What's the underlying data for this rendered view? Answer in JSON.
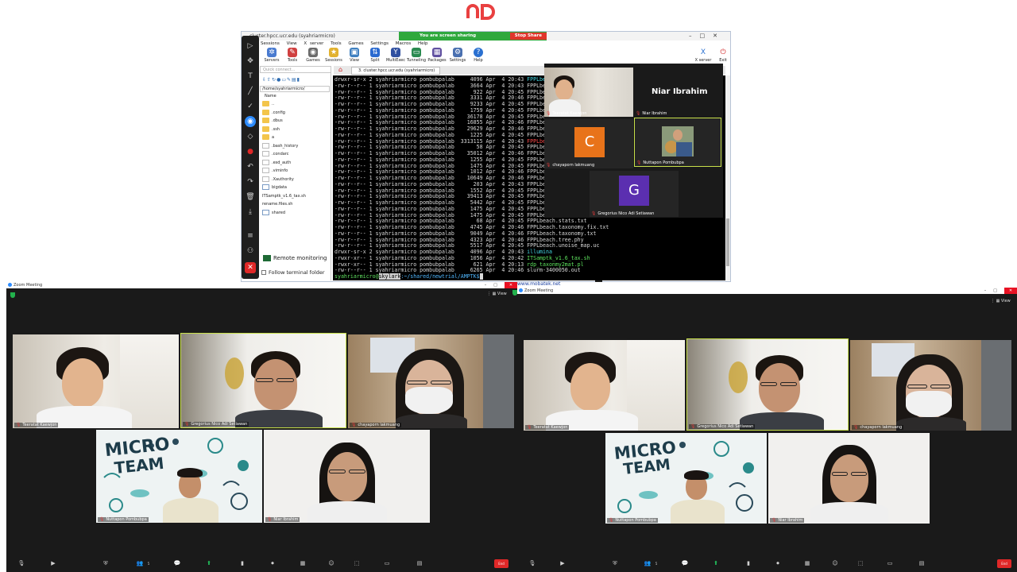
{
  "moba": {
    "window_title": "cluster.hpcc.ucr.edu (syahriarmicro)",
    "share_text": "You are screen sharing",
    "stop_share": "Stop Share",
    "menu": [
      "Sessions",
      "View",
      "X server",
      "Tools",
      "Games",
      "Settings",
      "Macros",
      "Help"
    ],
    "tools": [
      {
        "label": "Servers",
        "icon": "servers-icon",
        "color": "#4a7bd0"
      },
      {
        "label": "Tools",
        "icon": "tools-icon",
        "color": "#d04040"
      },
      {
        "label": "Games",
        "icon": "games-icon",
        "color": "#6a6a6a"
      },
      {
        "label": "Sessions",
        "icon": "sessions-icon",
        "color": "#e2b230"
      },
      {
        "label": "View",
        "icon": "view-icon",
        "color": "#4080c0"
      },
      {
        "label": "Split",
        "icon": "split-icon",
        "color": "#2a6ad0"
      },
      {
        "label": "MultiExec",
        "icon": "multiexec-icon",
        "color": "#3050a0"
      },
      {
        "label": "Tunneling",
        "icon": "tunneling-icon",
        "color": "#2a8a50"
      },
      {
        "label": "Packages",
        "icon": "packages-icon",
        "color": "#6050a0"
      },
      {
        "label": "Settings",
        "icon": "settings-icon",
        "color": "#4a70b0"
      },
      {
        "label": "Help",
        "icon": "help-icon",
        "color": "#2a70d0"
      }
    ],
    "xserver_label": "X server",
    "exit_label": "Exit",
    "quick_connect": "Quick connect...",
    "path": "/home/syahriarmicro/",
    "name_header": "Name",
    "files": [
      {
        "name": "..",
        "type": "folder"
      },
      {
        "name": ".config",
        "type": "folder"
      },
      {
        "name": ".dbus",
        "type": "folder"
      },
      {
        "name": ".ssh",
        "type": "folder"
      },
      {
        "name": "a",
        "type": "folder"
      },
      {
        "name": ".bash_history",
        "type": "doc"
      },
      {
        "name": ".condarc",
        "type": "doc"
      },
      {
        "name": ".esd_auth",
        "type": "doc"
      },
      {
        "name": ".viminfo",
        "type": "doc"
      },
      {
        "name": ".Xauthority",
        "type": "doc"
      },
      {
        "name": "bigdata",
        "type": "sh"
      },
      {
        "name": "ITSamptk_v1.6_tax.sh",
        "type": "term"
      },
      {
        "name": "rename.files.sh",
        "type": "term"
      },
      {
        "name": "shared",
        "type": "sh"
      }
    ],
    "remote_monitoring": "Remote monitoring",
    "follow_folder": "Follow terminal folder",
    "tab_label": "3. cluster.hpcc.ucr.edu (syahriarmicro)",
    "terminal_lines": [
      {
        "perm": "drwxr-sr-x 2",
        "user": "syahriarmicro pombubpalab",
        "size": "4096",
        "date": "Apr  4 20:43",
        "name": "FPPLbeach",
        "cls": "cyan"
      },
      {
        "perm": "-rw-r--r-- 1",
        "user": "syahriarmicro pombubpalab",
        "size": "3664",
        "date": "Apr  4 20:43",
        "name": "FPPLbeach",
        "cls": ""
      },
      {
        "perm": "-rw-r--r-- 1",
        "user": "syahriarmicro pombubpalab",
        "size": "922",
        "date": "Apr  4 20:45",
        "name": "FPPLbeach",
        "cls": ""
      },
      {
        "perm": "-rw-r--r-- 1",
        "user": "syahriarmicro pombubpalab",
        "size": "3331",
        "date": "Apr  4 20:46",
        "name": "FPPLbeach",
        "cls": ""
      },
      {
        "perm": "-rw-r--r-- 1",
        "user": "syahriarmicro pombubpalab",
        "size": "9233",
        "date": "Apr  4 20:45",
        "name": "FPPLbeach",
        "cls": ""
      },
      {
        "perm": "-rw-r--r-- 1",
        "user": "syahriarmicro pombubpalab",
        "size": "1759",
        "date": "Apr  4 20:45",
        "name": "FPPLbeach",
        "cls": ""
      },
      {
        "perm": "-rw-r--r-- 1",
        "user": "syahriarmicro pombubpalab",
        "size": "36178",
        "date": "Apr  4 20:45",
        "name": "FPPLbeach",
        "cls": ""
      },
      {
        "perm": "-rw-r--r-- 1",
        "user": "syahriarmicro pombubpalab",
        "size": "16855",
        "date": "Apr  4 20:46",
        "name": "FPPLbeach",
        "cls": ""
      },
      {
        "perm": "-rw-r--r-- 1",
        "user": "syahriarmicro pombubpalab",
        "size": "29629",
        "date": "Apr  4 20:46",
        "name": "FPPLbeach",
        "cls": ""
      },
      {
        "perm": "-rw-r--r-- 1",
        "user": "syahriarmicro pombubpalab",
        "size": "1225",
        "date": "Apr  4 20:45",
        "name": "FPPLbeach",
        "cls": ""
      },
      {
        "perm": "-rw-r--r-- 1",
        "user": "syahriarmicro pombubpalab",
        "size": "3313115",
        "date": "Apr  4 20:43",
        "name": "FPPLbeach",
        "cls": "red"
      },
      {
        "perm": "-rw-r--r-- 1",
        "user": "syahriarmicro pombubpalab",
        "size": "58",
        "date": "Apr  4 20:45",
        "name": "FPPLbeach",
        "cls": ""
      },
      {
        "perm": "-rw-r--r-- 1",
        "user": "syahriarmicro pombubpalab",
        "size": "35012",
        "date": "Apr  4 20:46",
        "name": "FPPLbeach",
        "cls": ""
      },
      {
        "perm": "-rw-r--r-- 1",
        "user": "syahriarmicro pombubpalab",
        "size": "1255",
        "date": "Apr  4 20:45",
        "name": "FPPLbeach",
        "cls": ""
      },
      {
        "perm": "-rw-r--r-- 1",
        "user": "syahriarmicro pombubpalab",
        "size": "1475",
        "date": "Apr  4 20:45",
        "name": "FPPLbeach",
        "cls": ""
      },
      {
        "perm": "-rw-r--r-- 1",
        "user": "syahriarmicro pombubpalab",
        "size": "1012",
        "date": "Apr  4 20:46",
        "name": "FPPLbeach",
        "cls": ""
      },
      {
        "perm": "-rw-r--r-- 1",
        "user": "syahriarmicro pombubpalab",
        "size": "10649",
        "date": "Apr  4 20:46",
        "name": "FPPLbeach",
        "cls": ""
      },
      {
        "perm": "-rw-r--r-- 1",
        "user": "syahriarmicro pombubpalab",
        "size": "203",
        "date": "Apr  4 20:43",
        "name": "FPPLbeach",
        "cls": ""
      },
      {
        "perm": "-rw-r--r-- 1",
        "user": "syahriarmicro pombubpalab",
        "size": "1552",
        "date": "Apr  4 20:45",
        "name": "FPPLbeach",
        "cls": ""
      },
      {
        "perm": "-rw-r--r-- 1",
        "user": "syahriarmicro pombubpalab",
        "size": "39413",
        "date": "Apr  4 20:45",
        "name": "FPPLbeach",
        "cls": ""
      },
      {
        "perm": "-rw-r--r-- 1",
        "user": "syahriarmicro pombubpalab",
        "size": "5442",
        "date": "Apr  4 20:45",
        "name": "FPPLbeach",
        "cls": ""
      },
      {
        "perm": "-rw-r--r-- 1",
        "user": "syahriarmicro pombubpalab",
        "size": "1475",
        "date": "Apr  4 20:45",
        "name": "FPPLbeach",
        "cls": ""
      },
      {
        "perm": "-rw-r--r-- 1",
        "user": "syahriarmicro pombubpalab",
        "size": "1475",
        "date": "Apr  4 20:45",
        "name": "FPPLbeach",
        "cls": ""
      },
      {
        "perm": "-rw-r--r-- 1",
        "user": "syahriarmicro pombubpalab",
        "size": "68",
        "date": "Apr  4 20:45",
        "name": "FPPLbeach.stats.txt",
        "cls": ""
      },
      {
        "perm": "-rw-r--r-- 1",
        "user": "syahriarmicro pombubpalab",
        "size": "4745",
        "date": "Apr  4 20:46",
        "name": "FPPLbeach.taxonomy.fix.txt",
        "cls": ""
      },
      {
        "perm": "-rw-r--r-- 1",
        "user": "syahriarmicro pombubpalab",
        "size": "9049",
        "date": "Apr  4 20:46",
        "name": "FPPLbeach.taxonomy.txt",
        "cls": ""
      },
      {
        "perm": "-rw-r--r-- 1",
        "user": "syahriarmicro pombubpalab",
        "size": "4323",
        "date": "Apr  4 20:46",
        "name": "FPPLbeach.tree.phy",
        "cls": ""
      },
      {
        "perm": "-rw-r--r-- 1",
        "user": "syahriarmicro pombubpalab",
        "size": "5517",
        "date": "Apr  4 20:45",
        "name": "FPPLbeach.unoise_map.uc",
        "cls": ""
      },
      {
        "perm": "drwxr-sr-x 2",
        "user": "syahriarmicro pombubpalab",
        "size": "4096",
        "date": "Apr  4 20:43",
        "name": "illumina",
        "cls": "cyan"
      },
      {
        "perm": "-rwxr-xr-- 1",
        "user": "syahriarmicro pombubpalab",
        "size": "1056",
        "date": "Apr  4 20:42",
        "name": "ITSamptk_v1.6_tax.sh",
        "cls": "green"
      },
      {
        "perm": "-rwxr-xr-- 1",
        "user": "syahriarmicro pombubpalab",
        "size": "621",
        "date": "Apr  4 20:13",
        "name": "rdp_taxonmy2mat.pl",
        "cls": "green"
      },
      {
        "perm": "-rw-r--r-- 1",
        "user": "syahriarmicro pombubpalab",
        "size": "6265",
        "date": "Apr  4 20:46",
        "name": "slurm-3400050.out",
        "cls": ""
      }
    ],
    "prompt_user": "syahriarmicro@",
    "prompt_host": "skylark",
    "prompt_path": ":~/shared/newtrial/AMPTK$",
    "url_footer": "www.mobatek.net"
  },
  "zoom_gallery": {
    "big_name": "Niar Ibrahim",
    "tiles": [
      {
        "name": "Teeratat Kaewjon"
      },
      {
        "name": "Niar Ibrahim"
      },
      {
        "name": "chayaporn lakmuang",
        "initial": "C",
        "color": "#e8731a"
      },
      {
        "name": "Nuttapon Pombubpa"
      },
      {
        "name": "Gregorius Nico Adi Setiawan",
        "initial": "G",
        "color": "#5b2fb0"
      }
    ]
  },
  "zoom_windows": [
    {
      "title": "Zoom Meeting",
      "view_label": "View",
      "participants": [
        "Teeratat Kaewjon",
        "Gregorius Nico Adi Setiawan",
        "chayaporn lakmuang",
        "Nuttapon Pombubpa",
        "Niar Ibrahim"
      ],
      "end_label": "End",
      "participant_count": "5"
    },
    {
      "title": "Zoom Meeting",
      "view_label": "View",
      "participants": [
        "Teeratat Kaewjon",
        "Gregorius Nico Adi Setiawan",
        "chayaporn lakmuang",
        "Nuttapon Pombubpa",
        "Niar Ibrahim"
      ],
      "end_label": "End",
      "participant_count": "5"
    }
  ],
  "micro_team_text": [
    "MICRO",
    "TEAM"
  ],
  "colors": {
    "accent_red": "#e02828",
    "active_border": "#c8e04a",
    "share_green": "#2fa83d"
  }
}
